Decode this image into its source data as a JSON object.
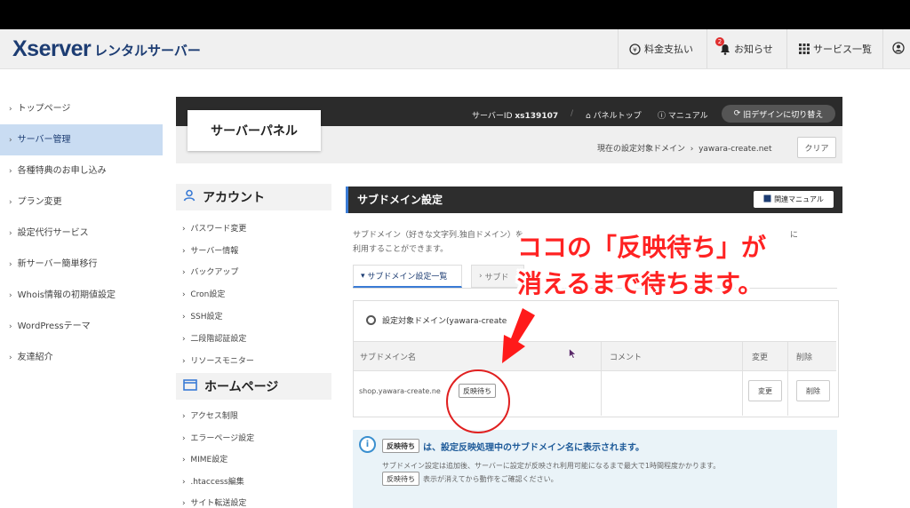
{
  "header": {
    "brand": "Xserver",
    "brand_sub": "レンタルサーバー",
    "nav": {
      "billing": "料金支払い",
      "notices": "お知らせ",
      "notice_count": "2",
      "services": "サービス一覧"
    }
  },
  "sidebar": {
    "items": [
      {
        "label": "トップページ",
        "active": false
      },
      {
        "label": "サーバー管理",
        "active": true
      },
      {
        "label": "各種特典のお申し込み",
        "active": false
      },
      {
        "label": "プラン変更",
        "active": false
      },
      {
        "label": "設定代行サービス",
        "active": false
      },
      {
        "label": "新サーバー簡単移行",
        "active": false
      },
      {
        "label": "Whois情報の初期値設定",
        "active": false
      },
      {
        "label": "WordPressテーマ",
        "active": false
      },
      {
        "label": "友達紹介",
        "active": false
      }
    ]
  },
  "panel": {
    "title": "サーバーパネル",
    "server_id_label": "サーバーID",
    "server_id": "xs139107",
    "panel_top": "パネルトップ",
    "manual": "マニュアル",
    "redesign": "旧デザインに切り替え",
    "target_domain_label": "現在の設定対象ドメイン",
    "target_domain": "yawara-create.net",
    "clear": "クリア"
  },
  "left_menu": {
    "account": {
      "title": "アカウント",
      "items": [
        "パスワード変更",
        "サーバー情報",
        "バックアップ",
        "Cron設定",
        "SSH設定",
        "二段階認証設定",
        "リソースモニター"
      ]
    },
    "homepage": {
      "title": "ホームページ",
      "items": [
        "アクセス制限",
        "エラーページ設定",
        "MIME設定",
        ".htaccess編集",
        "サイト転送設定"
      ]
    }
  },
  "main": {
    "section_title": "サブドメイン設定",
    "manual_button": "関連マニュアル",
    "description_1": "サブドメイン（好きな文字列.独自ドメイン）を",
    "description_1b": "に",
    "description_2": "利用することができます。",
    "tab_list": "サブドメイン設定一覧",
    "tab_add": "サブド",
    "target_label": "設定対象ドメイン",
    "target_value": "yawara-create",
    "columns": {
      "name": "サブドメイン名",
      "comment": "コメント",
      "change": "変更",
      "delete": "削除"
    },
    "rows": [
      {
        "name": "shop.yawara-create.ne",
        "status": "反映待ち",
        "comment": "",
        "change": "変更",
        "delete": "削除"
      }
    ],
    "info": {
      "tag": "反映待ち",
      "line1": "は、設定反映処理中のサブドメイン名に表示されます。",
      "line2": "サブドメイン設定は追加後、サーバーに設定が反映され利用可能になるまで最大で1時間程度かかります。",
      "line3": "表示が消えてから動作をご確認ください。"
    }
  },
  "annotation": {
    "line1": "ココの「反映待ち」が",
    "line2": "消えるまで待ちます。"
  },
  "colors": {
    "accent": "#3a7bd5",
    "brand": "#1d3d73",
    "annotation": "#ff2222"
  }
}
